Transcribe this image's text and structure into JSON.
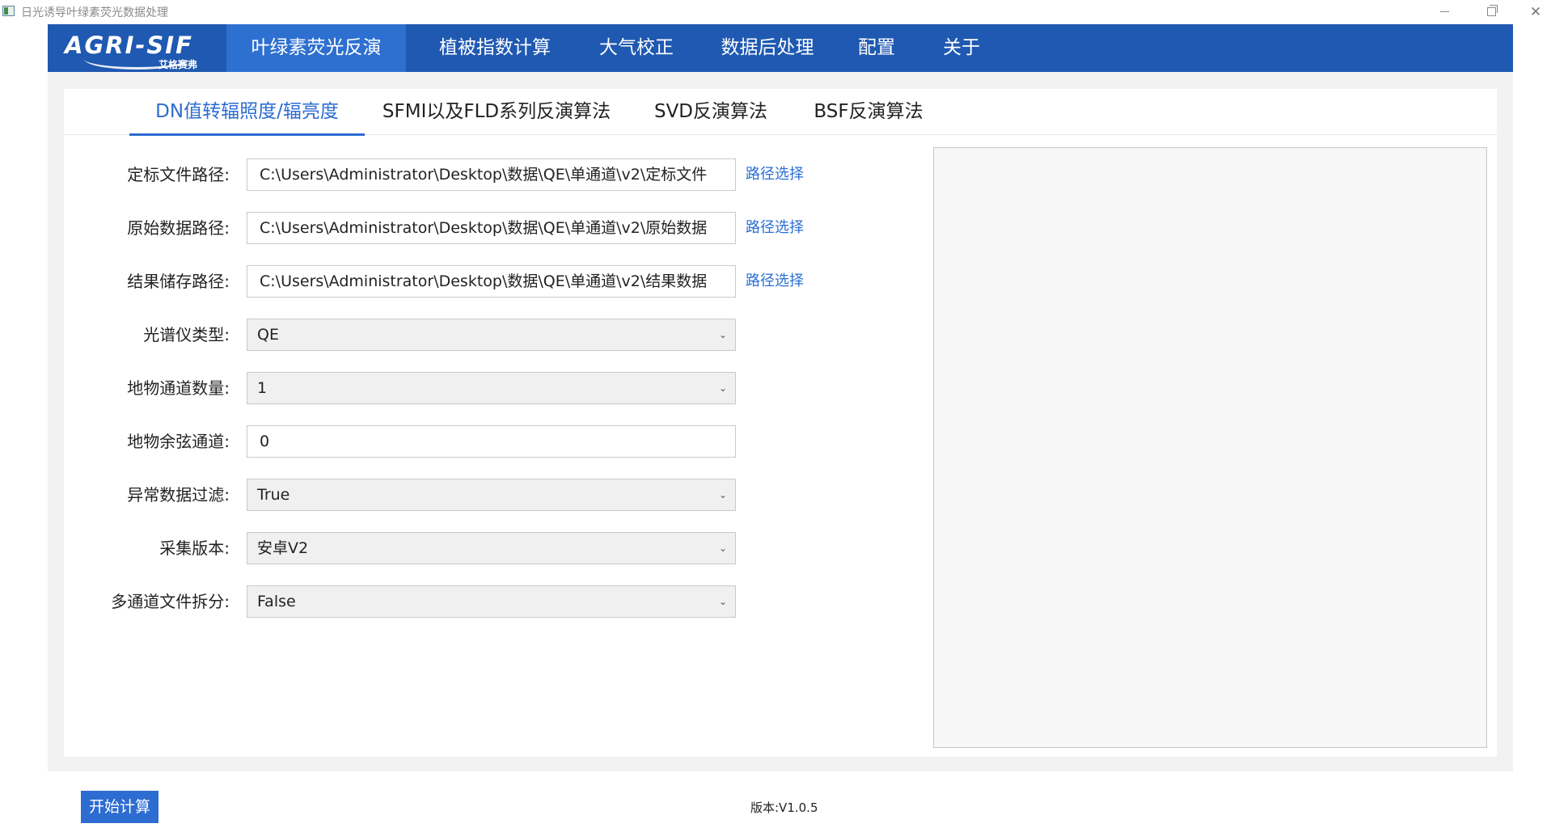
{
  "window": {
    "title": "日光诱导叶绿素荧光数据处理"
  },
  "logo": {
    "brand": "AGRI-SIF",
    "sub": "艾格赛弗"
  },
  "nav": {
    "items": [
      {
        "label": "叶绿素荧光反演"
      },
      {
        "label": "植被指数计算"
      },
      {
        "label": "大气校正"
      },
      {
        "label": "数据后处理"
      },
      {
        "label": "配置"
      },
      {
        "label": "关于"
      }
    ],
    "active_index": 0
  },
  "subtabs": {
    "items": [
      {
        "label": "DN值转辐照度/辐亮度"
      },
      {
        "label": "SFMI以及FLD系列反演算法"
      },
      {
        "label": "SVD反演算法"
      },
      {
        "label": "BSF反演算法"
      }
    ],
    "active_index": 0
  },
  "form": {
    "calib_path": {
      "label": "定标文件路径:",
      "value": "C:\\Users\\Administrator\\Desktop\\数据\\QE\\单通道\\v2\\定标文件",
      "button": "路径选择"
    },
    "raw_path": {
      "label": "原始数据路径:",
      "value": "C:\\Users\\Administrator\\Desktop\\数据\\QE\\单通道\\v2\\原始数据",
      "button": "路径选择"
    },
    "result_path": {
      "label": "结果储存路径:",
      "value": "C:\\Users\\Administrator\\Desktop\\数据\\QE\\单通道\\v2\\结果数据",
      "button": "路径选择"
    },
    "spectrometer": {
      "label": "光谱仪类型:",
      "value": "QE"
    },
    "channel_count": {
      "label": "地物通道数量:",
      "value": "1"
    },
    "cosine_channel": {
      "label": "地物余弦通道:",
      "value": "0"
    },
    "anomaly_filter": {
      "label": "异常数据过滤:",
      "value": "True"
    },
    "capture_version": {
      "label": "采集版本:",
      "value": "安卓V2"
    },
    "multi_split": {
      "label": "多通道文件拆分:",
      "value": "False"
    }
  },
  "footer": {
    "start_button": "开始计算",
    "version": "版本:V1.0.5"
  },
  "colors": {
    "nav_bg": "#1f59b1",
    "nav_active": "#2e70d0",
    "accent": "#2d6cd0",
    "link": "#2a6fd6"
  }
}
